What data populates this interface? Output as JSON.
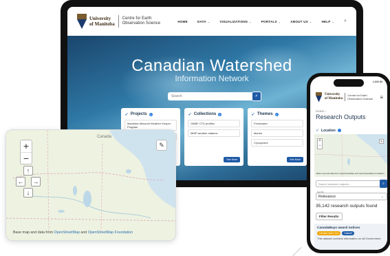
{
  "logo": {
    "university_line1": "University",
    "university_line2": "of Manitoba",
    "centre_line1": "Centre for Earth",
    "centre_line2": "Observation Science"
  },
  "nav": {
    "items": [
      "HOME",
      "DATA",
      "VISUALIZATIONS",
      "PORTALS",
      "ABOUT US",
      "HELP"
    ],
    "search_icon": "search-icon"
  },
  "hero": {
    "title": "Canadian Watershed",
    "subtitle": "Information Network",
    "search_placeholder": "Search"
  },
  "cards": [
    {
      "title": "Projects",
      "items": [
        "Manitoba Mesonet Weather Keeper Program",
        "Hudson Bay System Study (BaySys)"
      ],
      "more": ""
    },
    {
      "title": "Collections",
      "items": [
        "GMBF CTD profiles",
        "MMP weather stations"
      ],
      "more": "See More"
    },
    {
      "title": "Themes",
      "items": [
        "Freshwater",
        "Marine",
        "Cryosphere"
      ],
      "more": "See More"
    }
  ],
  "map": {
    "label": "Canada",
    "attribution_prefix": "Base map and data from",
    "attribution_link1": "OpenStreetMap",
    "attribution_and": "and",
    "attribution_link2": "OpenStreetMap Foundation"
  },
  "phone": {
    "login": "LOG IN",
    "breadcrumb": "Home  ›",
    "title": "Research Outputs",
    "section": "Location",
    "map_attribution": "Base map and data from OpenStreetMap and OpenStreetMap Foundation",
    "search_placeholder": "Search research outputs...",
    "sort_label": "Sort By",
    "sort_value": "Relevance",
    "count": "35,142 research outputs found",
    "filter": "Filter Results",
    "result_title": "CanadaBuys award notices",
    "badge1": "Canada Open Gov",
    "badge2": "Dataset",
    "result_text": "This dataset contains information on all Government"
  },
  "colors": {
    "accent": "#1f5aa6",
    "brand_navy": "#1e3550",
    "info_dot": "#2b7de0"
  }
}
